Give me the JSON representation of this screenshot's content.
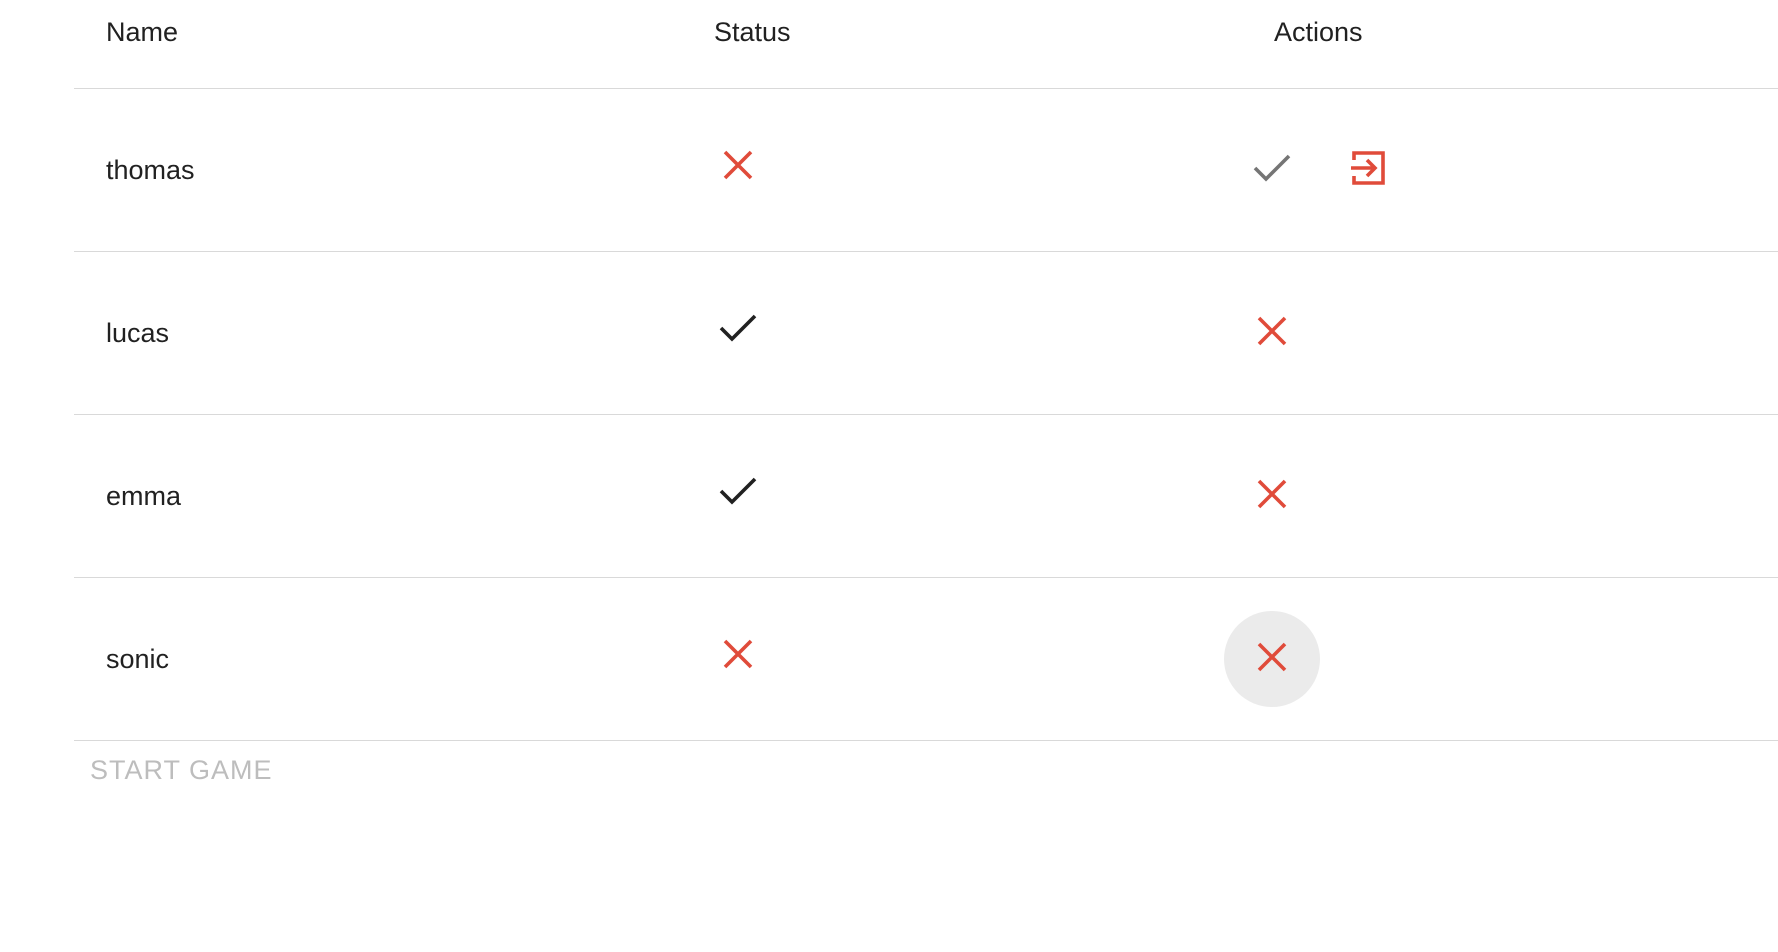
{
  "table": {
    "headers": {
      "name": "Name",
      "status": "Status",
      "actions": "Actions"
    },
    "rows": [
      {
        "name": "thomas",
        "status_icon": "close-icon",
        "actions": [
          "check-icon",
          "exit-to-app-icon"
        ]
      },
      {
        "name": "lucas",
        "status_icon": "check-icon",
        "actions": [
          "close-icon"
        ]
      },
      {
        "name": "emma",
        "status_icon": "check-icon",
        "actions": [
          "close-icon"
        ]
      },
      {
        "name": "sonic",
        "status_icon": "close-icon",
        "actions": [
          "close-icon"
        ]
      }
    ]
  },
  "footer": {
    "start_label": "START GAME"
  },
  "colors": {
    "accent_red": "#e04b3a",
    "check_dark": "#212121",
    "check_grey": "#757575",
    "disabled_text": "#bdbdbd",
    "divider": "#d9d9d9",
    "hover_bg": "#ebebeb"
  }
}
